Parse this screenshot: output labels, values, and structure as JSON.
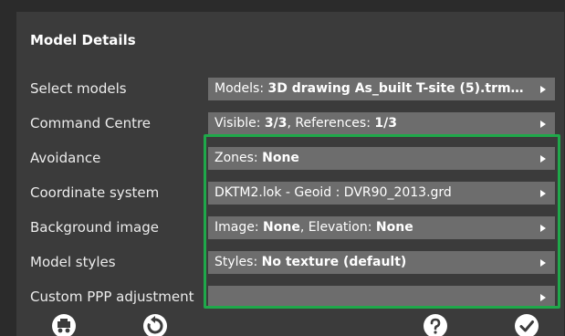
{
  "header": {
    "title": "Model Details"
  },
  "rows": [
    {
      "label": "Select models",
      "value_prefix": "Models: ",
      "value_bold": "3D drawing As_built T-site (5).trm…",
      "value_mid": "",
      "value_bold2": ""
    },
    {
      "label": "Command Centre",
      "value_prefix": "Visible: ",
      "value_bold": "3/3",
      "value_mid": ", References: ",
      "value_bold2": "1/3"
    },
    {
      "label": "Avoidance",
      "value_prefix": "Zones: ",
      "value_bold": "None",
      "value_mid": "",
      "value_bold2": ""
    },
    {
      "label": "Coordinate system",
      "value_prefix": "DKTM2.lok - Geoid : DVR90_2013.grd",
      "value_bold": "",
      "value_mid": "",
      "value_bold2": ""
    },
    {
      "label": "Background image",
      "value_prefix": "Image: ",
      "value_bold": "None",
      "value_mid": ", Elevation: ",
      "value_bold2": "None"
    },
    {
      "label": "Model styles",
      "value_prefix": "Styles: ",
      "value_bold": "No texture (default)",
      "value_mid": "",
      "value_bold2": ""
    },
    {
      "label": "Custom PPP adjustment",
      "value_prefix": "",
      "value_bold": "",
      "value_mid": "",
      "value_bold2": ""
    }
  ],
  "highlight_color": "#1fa84a",
  "icons": [
    "machine-icon",
    "reset-icon",
    "help-icon",
    "confirm-icon"
  ]
}
